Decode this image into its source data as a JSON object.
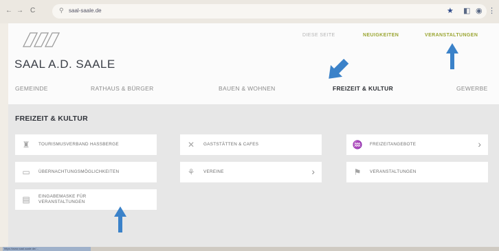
{
  "browser": {
    "url": "saal-saale.de",
    "nav_back": "←",
    "nav_forward": "→",
    "nav_reload": "C",
    "status_text": "https://www.saal-saale.de/..."
  },
  "site": {
    "name": "SAAL A.D. SAALE",
    "top_links": [
      "DIESE SEITE",
      "NEUIGKEITEN",
      "VERANSTALTUNGEN"
    ],
    "main_nav": [
      "GEMEINDE",
      "RATHAUS & BÜRGER",
      "BAUEN & WOHNEN",
      "FREIZEIT & KULTUR",
      "GEWERBE"
    ],
    "active_nav": "FREIZEIT & KULTUR"
  },
  "section": {
    "title": "FREIZEIT & KULTUR",
    "cards": [
      {
        "label": "TOURISMUSVERBAND HASSBERGE",
        "icon": "tower-icon",
        "has_chevron": false
      },
      {
        "label": "GASTSTÄTTEN & CAFES",
        "icon": "restaurant-icon",
        "has_chevron": false
      },
      {
        "label": "FREIZEITANGEBOTE",
        "icon": "swimmer-icon",
        "has_chevron": true
      },
      {
        "label": "ÜBERNACHTUNGSMÖGLICHKEITEN",
        "icon": "bed-icon",
        "has_chevron": false
      },
      {
        "label": "VEREINE",
        "icon": "group-icon",
        "has_chevron": true
      },
      {
        "label": "VERANSTALTUNGEN",
        "icon": "event-icon",
        "has_chevron": false
      },
      {
        "label": "EINGABEMASKE FÜR VERANSTALTUNGEN",
        "icon": "form-icon",
        "has_chevron": false
      }
    ]
  },
  "colors": {
    "accent_green": "#9aa531",
    "annotation_arrow": "#3b82c9"
  }
}
